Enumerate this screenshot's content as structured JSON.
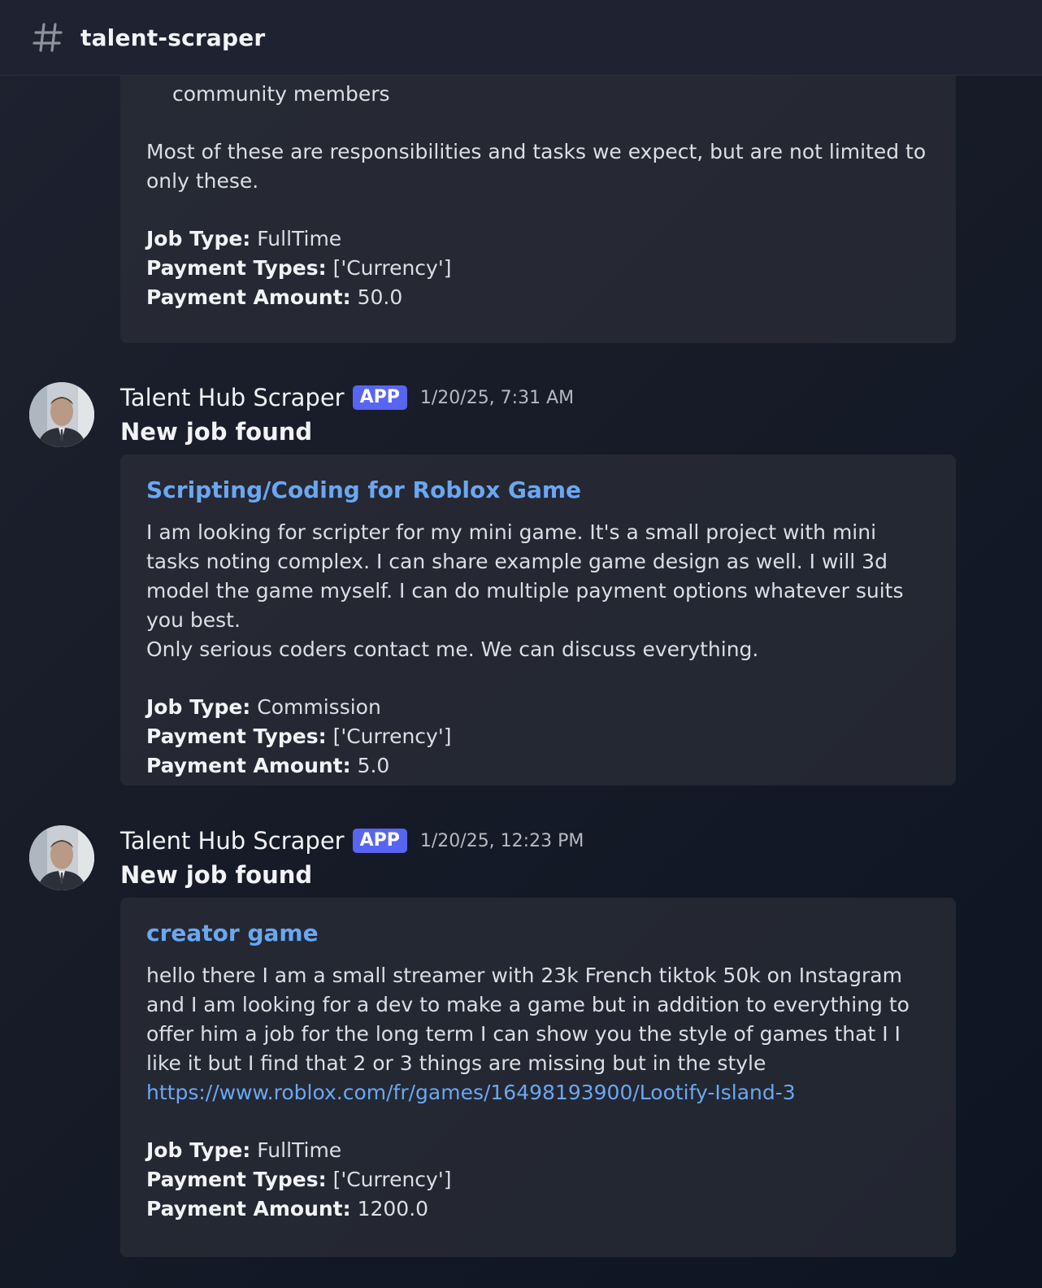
{
  "channel": {
    "name": "talent-scraper",
    "icon": "hash-icon"
  },
  "messages": [
    {
      "partial": true,
      "embed": {
        "bullet_tail": "community members",
        "description": "Most of these are responsibilities and tasks we expect, but are not limited to only these.",
        "fields": [
          {
            "label": "Job Type:",
            "value": " FullTime"
          },
          {
            "label": "Payment Types:",
            "value": " ['Currency']"
          },
          {
            "label": "Payment Amount:",
            "value": " 50.0"
          }
        ]
      }
    },
    {
      "author": "Talent Hub Scraper",
      "badge": "APP",
      "timestamp": "1/20/25, 7:31 AM",
      "content": "New job found",
      "embed": {
        "title": "Scripting/Coding for Roblox Game",
        "description": "I am looking for scripter for my mini game. It's a small project with mini tasks noting complex. I can share example game design as well. I will 3d model the game myself. I can do multiple payment options whatever suits you best.\nOnly serious coders contact me. We can discuss everything.",
        "fields": [
          {
            "label": "Job Type:",
            "value": " Commission"
          },
          {
            "label": "Payment Types:",
            "value": " ['Currency']"
          },
          {
            "label": "Payment Amount:",
            "value": " 5.0"
          }
        ]
      }
    },
    {
      "author": "Talent Hub Scraper",
      "badge": "APP",
      "timestamp": "1/20/25, 12:23 PM",
      "content": "New job found",
      "embed": {
        "title": "creator game",
        "description": "hello there I am a small streamer with 23k French tiktok 50k on Instagram and I am looking for a dev to make a game but in addition to everything to offer him a job for the long term I can show you the style of games that I I like it but I find that 2 or 3 things are missing but in the style",
        "link": "https://www.roblox.com/fr/games/16498193900/Lootify-Island-3",
        "fields": [
          {
            "label": "Job Type:",
            "value": " FullTime"
          },
          {
            "label": "Payment Types:",
            "value": " ['Currency']"
          },
          {
            "label": "Payment Amount:",
            "value": " 1200.0"
          }
        ]
      }
    }
  ]
}
